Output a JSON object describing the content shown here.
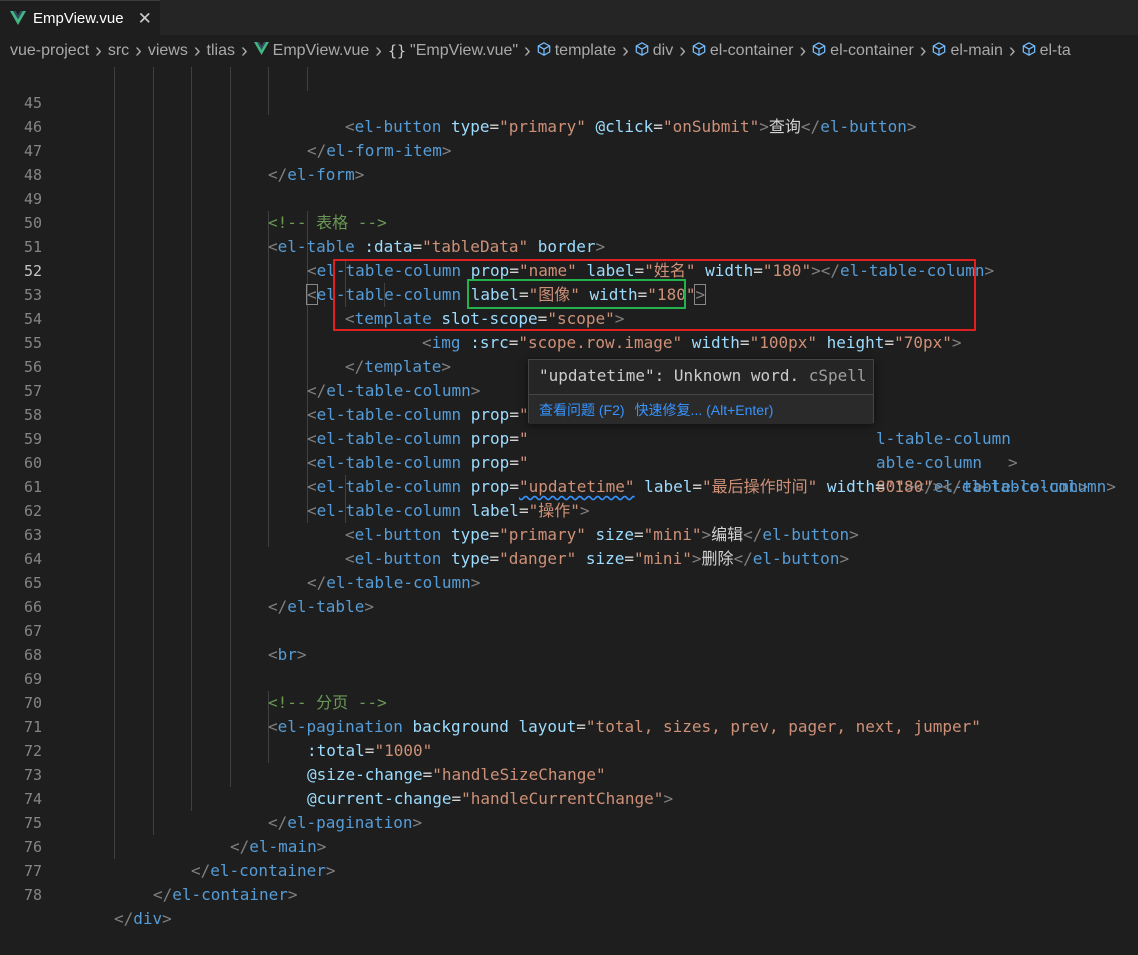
{
  "tab": {
    "title": "EmpView.vue",
    "close": "✕"
  },
  "breadcrumb": [
    {
      "label": "vue-project",
      "icon": ""
    },
    {
      "label": "src",
      "icon": ""
    },
    {
      "label": "views",
      "icon": ""
    },
    {
      "label": "tlias",
      "icon": ""
    },
    {
      "label": "EmpView.vue",
      "icon": "vue-icon"
    },
    {
      "label": "\"EmpView.vue\"",
      "icon": "braces-icon"
    },
    {
      "label": "template",
      "icon": "cube-icon"
    },
    {
      "label": "div",
      "icon": "cube-icon"
    },
    {
      "label": "el-container",
      "icon": "cube-icon"
    },
    {
      "label": "el-container",
      "icon": "cube-icon"
    },
    {
      "label": "el-main",
      "icon": "cube-icon"
    },
    {
      "label": "el-ta",
      "icon": "cube-icon"
    }
  ],
  "editor": {
    "active_line": "52",
    "line_numbers": [
      "45",
      "46",
      "47",
      "48",
      "49",
      "50",
      "51",
      "52",
      "53",
      "54",
      "55",
      "56",
      "57",
      "58",
      "59",
      "60",
      "61",
      "62",
      "63",
      "64",
      "65",
      "66",
      "67",
      "68",
      "69",
      "70",
      "71",
      "72",
      "73",
      "74",
      "75",
      "76",
      "77",
      "78"
    ]
  },
  "code": {
    "l45": {
      "t1": "<",
      "t2": "el-button",
      "a1": " type",
      "s1": "\"primary\"",
      "a2": " @click",
      "s2": "\"onSubmit\"",
      "p1": ">",
      "tx": "查询",
      "t3": "</",
      "t4": "el-button",
      "p2": ">"
    },
    "l46": {
      "t1": "</",
      "t2": "el-form-item",
      "p1": ">"
    },
    "l47": {
      "t1": "</",
      "t2": "el-form",
      "p1": ">"
    },
    "l49": {
      "c": "<!-- 表格 -->"
    },
    "l50": {
      "t1": "<",
      "t2": "el-table",
      "a1": " :data",
      "s1": "\"tableData\"",
      "a2": " border",
      "p1": ">"
    },
    "l51": {
      "t1": "<",
      "t2": "el-table-column",
      "a1": " prop",
      "s1": "\"name\"",
      "a2": " label",
      "s2": "\"姓名\"",
      "a3": " width",
      "s3": "\"180\"",
      "p1": "></",
      "t3": "el-table-column",
      "p2": ">"
    },
    "l52": {
      "t1": "<",
      "t2": "el-table-column",
      "a1": " label",
      "s1": "\"图像\"",
      "a2": " width",
      "s2": "\"180\"",
      "p1": ">"
    },
    "l53": {
      "t1": "<",
      "t2": "template",
      "a1": " slot-scope",
      "s1": "\"scope\"",
      "p1": ">"
    },
    "l54": {
      "t1": "<",
      "t2": "img",
      "a1": ":src",
      "s1": "\"scope.row.image\"",
      "a2": " width",
      "s2": "\"100px\"",
      "a3": " height",
      "s3": "\"70px\"",
      "p1": ">"
    },
    "l55": {
      "t1": "</",
      "t2": "template",
      "p1": ">"
    },
    "l56": {
      "t1": "</",
      "t2": "el-table-column",
      "p1": ">"
    },
    "l57": {
      "t1": "<",
      "t2": "el-table-column",
      "a1": " prop",
      "s1": "\"",
      "frag": "l-table-column",
      "p1": ">"
    },
    "l58": {
      "t1": "<",
      "t2": "el-table-column",
      "a1": " prop",
      "s1": "\"",
      "frag": "able-column",
      "p1": ">"
    },
    "l59": {
      "t1": "<",
      "t2": "el-table-column",
      "a1": " prop",
      "s1": "\"",
      "frag": "80\"",
      "t3": "el-table-column",
      "p1": "></",
      "p2": ">"
    },
    "l60": {
      "t1": "<",
      "t2": "el-table-column",
      "a1": " prop",
      "s1": "\"updatetime\"",
      "a2": " label",
      "s2": "\"最后操作时间\"",
      "a3": " width",
      "s3": "\"180\"",
      "p1": "></",
      "t3": "el-table-column",
      "p2": ">"
    },
    "l61": {
      "t1": "<",
      "t2": "el-table-column",
      "a1": " label",
      "s1": "\"操作\"",
      "p1": ">"
    },
    "l62": {
      "t1": "<",
      "t2": "el-button",
      "a1": " type",
      "s1": "\"primary\"",
      "a2": " size",
      "s2": "\"mini\"",
      "p1": ">",
      "tx": "编辑",
      "t3": "</",
      "t4": "el-button",
      "p2": ">"
    },
    "l63": {
      "t1": "<",
      "t2": "el-button",
      "a1": " type",
      "s1": "\"danger\"",
      "a2": " size",
      "s2": "\"mini\"",
      "p1": ">",
      "tx": "删除",
      "t3": "</",
      "t4": "el-button",
      "p2": ">"
    },
    "l64": {
      "t1": "</",
      "t2": "el-table-column",
      "p1": ">"
    },
    "l65": {
      "t1": "</",
      "t2": "el-table",
      "p1": ">"
    },
    "l67": {
      "t1": "<",
      "t2": "br",
      "p1": ">"
    },
    "l69": {
      "c": "<!-- 分页 -->"
    },
    "l70": {
      "t1": "<",
      "t2": "el-pagination",
      "a1": " background",
      "a2": " layout",
      "s1": "\"total, sizes, prev, pager, next, jumper\""
    },
    "l71": {
      "a1": ":total",
      "s1": "\"1000\""
    },
    "l72": {
      "a1": "@size-change",
      "s1": "\"handleSizeChange\""
    },
    "l73": {
      "a1": "@current-change",
      "s1": "\"handleCurrentChange\"",
      "p1": ">"
    },
    "l74": {
      "t1": "</",
      "t2": "el-pagination",
      "p1": ">"
    },
    "l75": {
      "t1": "</",
      "t2": "el-main",
      "p1": ">"
    },
    "l76": {
      "t1": "</",
      "t2": "el-container",
      "p1": ">"
    },
    "l77": {
      "t1": "</",
      "t2": "el-container",
      "p1": ">"
    },
    "l78": {
      "t1": "</",
      "t2": "div",
      "p1": ">"
    }
  },
  "hover": {
    "message": "\"updatetime\": Unknown word.",
    "source": "cSpell",
    "action_view": "查看问题 (F2)",
    "action_fix": "快速修复... (Alt+Enter)"
  },
  "colors": {
    "tag": "#569cd6",
    "attr": "#9cdcfe",
    "string": "#ce9178",
    "comment": "#6a9955",
    "highlight_red": "#e02020",
    "highlight_green": "#23b14d",
    "vue_green": "#41b883"
  }
}
